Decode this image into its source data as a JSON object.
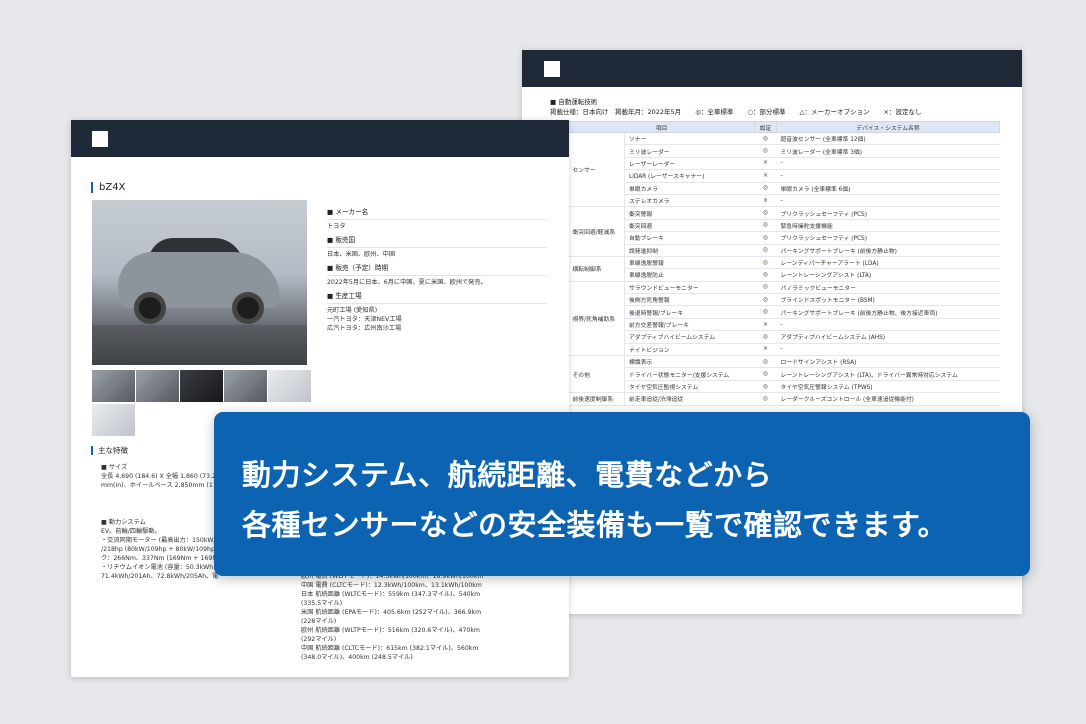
{
  "banner": {
    "line1": "動力システム、航続距離、電費などから",
    "line2": "各種センサーなどの安全装備も一覧で確認できます。"
  },
  "adas": {
    "section_title": "■ 自動運転技術",
    "sub_note": "掲載仕様：日本向け　掲載年月：2022年5月",
    "legend": [
      "◎：全車標準",
      "○：部分標準",
      "△：メーカーオプション",
      "×：設定なし"
    ],
    "headers": [
      "項目",
      "設定",
      "デバイス・システム名称"
    ],
    "groups": [
      {
        "name": "センサー",
        "rows": [
          {
            "item": "ソナー",
            "status": "◎",
            "device": "超音波センサー (全車標準 12個)"
          },
          {
            "item": "ミリ波レーダー",
            "status": "◎",
            "device": "ミリ波レーダー (全車標準 3個)"
          },
          {
            "item": "レーザーレーダー",
            "status": "×",
            "device": "-"
          },
          {
            "item": "LiDAR (レーザースキャナー)",
            "status": "×",
            "device": "-"
          },
          {
            "item": "単眼カメラ",
            "status": "◎",
            "device": "単眼カメラ (全車標準 6個)"
          },
          {
            "item": "ステレオカメラ",
            "status": "×",
            "device": "-"
          }
        ]
      },
      {
        "name": "衝突回避/軽減系",
        "rows": [
          {
            "item": "衝突警報",
            "status": "◎",
            "device": "プリクラッシュセーフティ (PCS)"
          },
          {
            "item": "衝突回避",
            "status": "◎",
            "device": "緊急時操舵支援機能"
          },
          {
            "item": "自動ブレーキ",
            "status": "◎",
            "device": "プリクラッシュセーフティ (PCS)"
          },
          {
            "item": "誤発進抑制",
            "status": "◎",
            "device": "パーキングサポートブレーキ (前後方静止物)"
          }
        ]
      },
      {
        "name": "横転制御系",
        "rows": [
          {
            "item": "車線逸脱警報",
            "status": "◎",
            "device": "レーンディパーチャーアラート (LDA)"
          },
          {
            "item": "車線逸脱防止",
            "status": "◎",
            "device": "レーントレーシングアシスト (LTA)"
          }
        ]
      },
      {
        "name": "視界/死角補助系",
        "rows": [
          {
            "item": "サラウンドビューモニター",
            "status": "◎",
            "device": "パノラミックビューモニター"
          },
          {
            "item": "後側方死角警報",
            "status": "◎",
            "device": "ブラインドスポットモニター (BSM)"
          },
          {
            "item": "後退時警報/ブレーキ",
            "status": "◎",
            "device": "パーキングサポートブレーキ (前後方静止物、後方接近車両)"
          },
          {
            "item": "前方交差警報/ブレーキ",
            "status": "×",
            "device": "-"
          },
          {
            "item": "アダプティブハイビームシステム",
            "status": "◎",
            "device": "アダプティブハイビームシステム (AHS)"
          },
          {
            "item": "ナイトビジョン",
            "status": "×",
            "device": "-"
          }
        ]
      },
      {
        "name": "その他",
        "rows": [
          {
            "item": "標識表示",
            "status": "◎",
            "device": "ロードサインアシスト (RSA)"
          },
          {
            "item": "ドライバー状態モニター/支援システム",
            "status": "◎",
            "device": "レーントレーシングアシスト (LTA)、ドライバー異常時対応システム"
          },
          {
            "item": "タイヤ空気圧監視システム",
            "status": "◎",
            "device": "タイヤ空気圧警報システム (TPWS)"
          }
        ]
      },
      {
        "name": "前後速度制御系",
        "rows": [
          {
            "item": "前走車追従/渋滞追従",
            "status": "◎",
            "device": "レーダークルーズコントロール (全車速追従機能付)"
          }
        ]
      }
    ]
  },
  "car": {
    "title": "bZ4X",
    "spec": [
      {
        "label": "■ メーカー名",
        "value": [
          "トヨタ"
        ]
      },
      {
        "label": "■ 販売国",
        "value": [
          "日本、米国、欧州、中国"
        ]
      },
      {
        "label": "■ 販売（予定）時期",
        "value": [
          "2022年5月に日本、6月に中国、夏に米国、欧州で発売。"
        ]
      },
      {
        "label": "■ 生産工場",
        "value": [
          "元町工場 (愛知県)",
          "一汽トヨタ：天津NEV工場",
          "広汽トヨタ：広州南沙工場"
        ]
      }
    ],
    "features_title": "主な特徴",
    "size_label": "■ サイズ",
    "size_text": [
      "全長 4,690 (184.6) X 全幅 1,860 (73.2",
      "mm(in)、ホイールベース 2,850mm (112"
    ],
    "power_label": "■ 動力システム",
    "power_text": [
      "EV。前輪/四輪駆動。",
      "・交流同期モーター (最高出力：150kW/2",
      "/218hp (80kW/109hp + 80kW/109hp",
      "ク：266Nm、337Nm (169Nm + 169N",
      "・リチウムイオン電池 (容量：50.3kWh,",
      "71.4kWh/201Ah、72.8kWh/205Ah、電"
    ],
    "range_text": [
      "欧州 電費 (WLTPモード)：14.3kWh/100km、18.9kWh/100km",
      "中国 電費 (CLTCモード)：12.3kWh/100km、13.1kWh/100km",
      "日本 航続距離 (WLTCモード)：559km (347.3マイル)、540km",
      "(335.5マイル)",
      "米国 航続距離 (EPAモード)：405.6km (252マイル)、366.9km",
      "(228マイル)",
      "欧州 航続距離 (WLTPモード)：516km (320.6マイル)、470km",
      "(292マイル)",
      "中国 航続距離 (CLTCモード)：615km (382.1マイル)、560km",
      "(348.0マイル)、400km (248.5マイル)"
    ]
  }
}
